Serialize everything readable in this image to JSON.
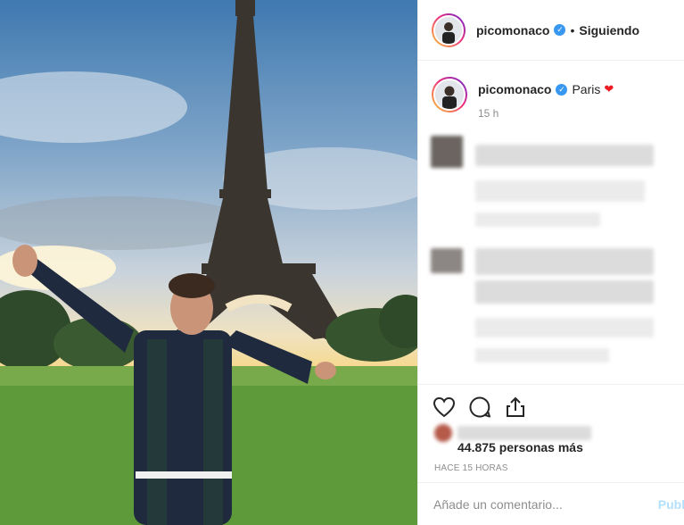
{
  "post": {
    "username": "picomonaco",
    "verified_mark": "✓",
    "separator": "•",
    "follow_status": "Siguiendo"
  },
  "caption": {
    "username": "picomonaco",
    "verified_mark": "✓",
    "text": "Paris",
    "emoji": "❤",
    "time": "15 h"
  },
  "actions": {
    "likes_text": "44.875 personas más",
    "time_ago": "HACE 15 HORAS"
  },
  "comment": {
    "placeholder": "Añade un comentario...",
    "publish_label": "Publi"
  },
  "icons": {
    "like": "heart-icon",
    "comment": "comment-icon",
    "share": "share-icon",
    "verified": "verified-badge-icon"
  },
  "colors": {
    "verified_blue": "#3897f0",
    "heart_red": "#ed1c24",
    "publish_disabled": "#b2dffc",
    "muted_text": "#8e8e8e"
  }
}
